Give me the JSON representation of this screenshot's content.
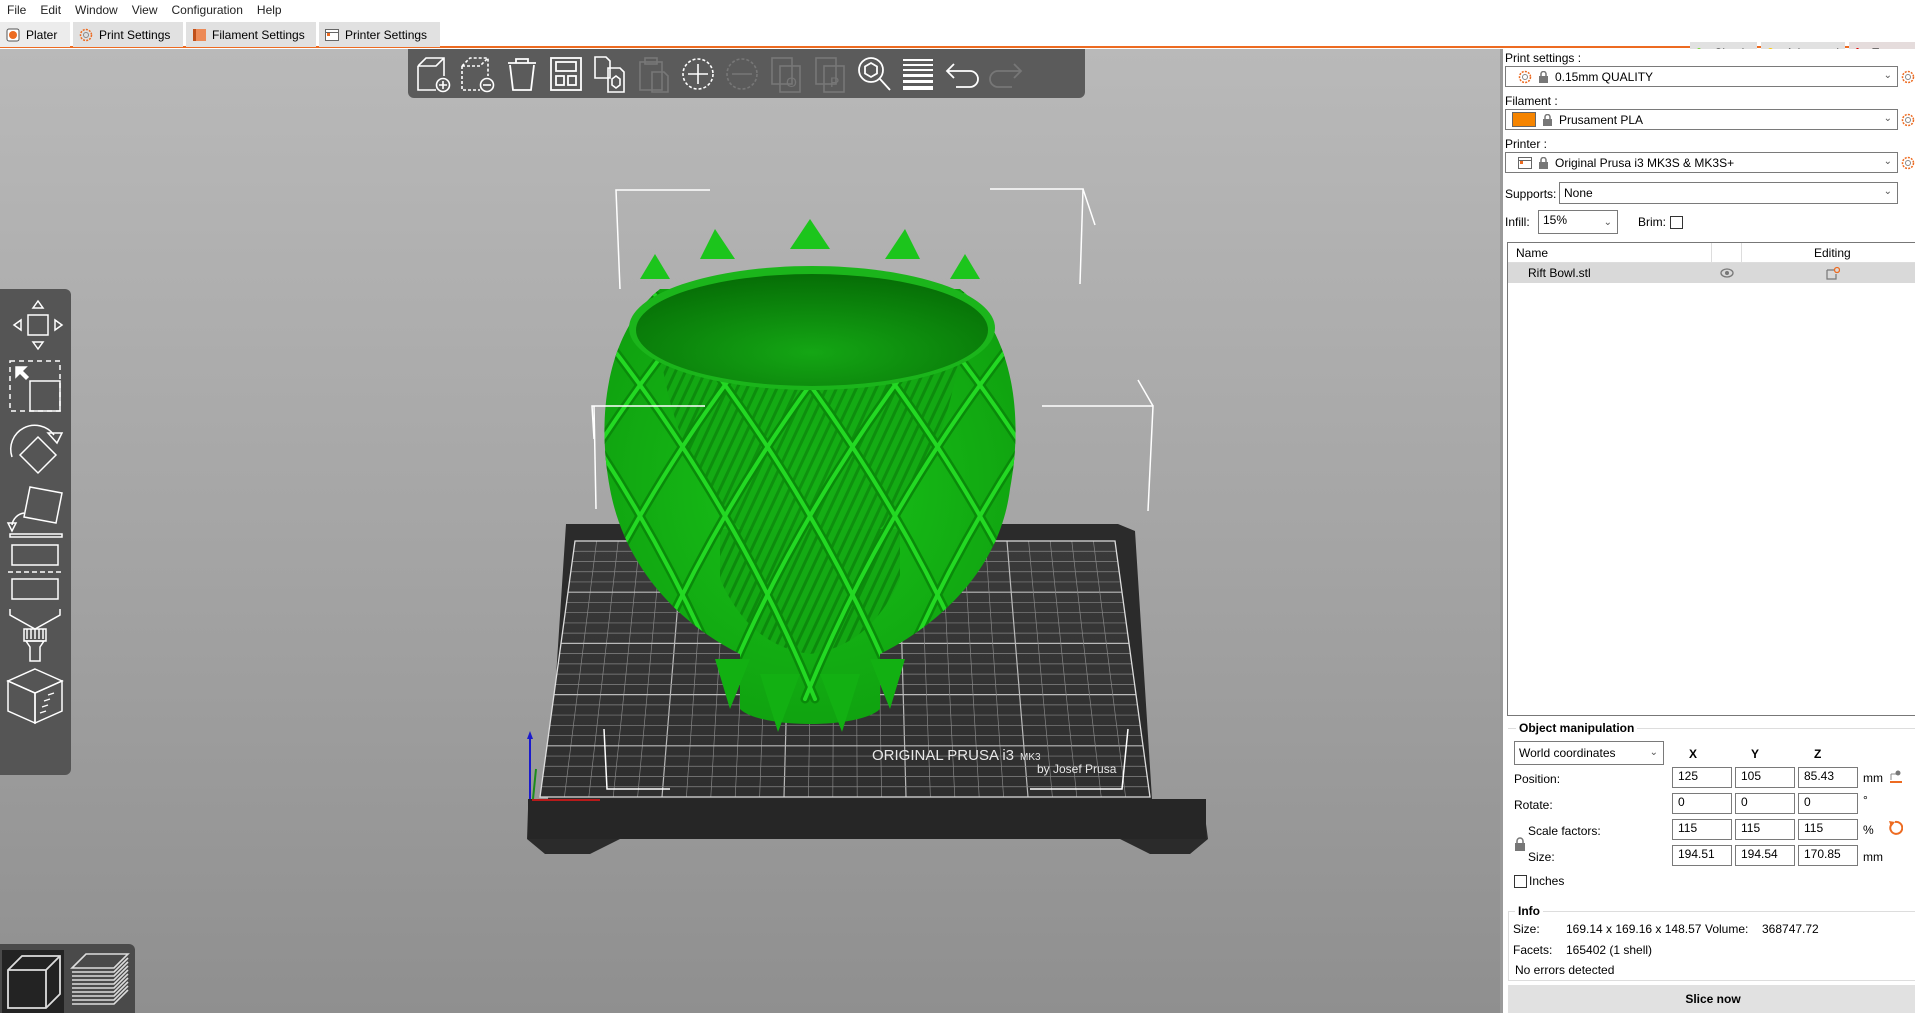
{
  "menu": [
    "File",
    "Edit",
    "Window",
    "View",
    "Configuration",
    "Help"
  ],
  "tabs": [
    {
      "label": "Plater",
      "icon": "plater-icon",
      "active": true
    },
    {
      "label": "Print Settings",
      "icon": "print-settings-icon"
    },
    {
      "label": "Filament Settings",
      "icon": "filament-icon"
    },
    {
      "label": "Printer Settings",
      "icon": "printer-icon"
    }
  ],
  "modes": [
    {
      "label": "Simple",
      "color": "#6dd42a"
    },
    {
      "label": "Advanced",
      "color": "#ffcc00"
    },
    {
      "label": "Expert",
      "color": "#e20000",
      "active": true
    }
  ],
  "toolbar": [
    "add",
    "delete",
    "delete-all",
    "arrange",
    "copy",
    "paste",
    "add-instance",
    "remove-instance",
    "split-objects",
    "split-parts",
    "search",
    "layers-editing",
    "undo",
    "redo"
  ],
  "left_tools": [
    "move",
    "scale",
    "rotate",
    "place-on-face",
    "cut",
    "paint-supports",
    "seam"
  ],
  "bed": {
    "label_line1": "ORIGINAL PRUSA i3",
    "label_small": "MK3",
    "label_line2": "by Josef Prusa"
  },
  "sidebar": {
    "print_settings_label": "Print settings :",
    "print_settings_value": "0.15mm QUALITY",
    "filament_label": "Filament :",
    "filament_value": "Prusament PLA",
    "filament_color": "#f58400",
    "printer_label": "Printer :",
    "printer_value": "Original Prusa i3 MK3S & MK3S+",
    "supports_label": "Supports:",
    "supports_value": "None",
    "infill_label": "Infill:",
    "infill_value": "15%",
    "brim_label": "Brim:",
    "brim_checked": false
  },
  "object_list": {
    "col_name": "Name",
    "col_editing": "Editing",
    "rows": [
      {
        "name": "Rift Bowl.stl"
      }
    ]
  },
  "manipulation": {
    "title": "Object manipulation",
    "coord_system": "World coordinates",
    "axes": [
      "X",
      "Y",
      "Z"
    ],
    "position_label": "Position:",
    "position": [
      "125",
      "105",
      "85.43"
    ],
    "position_unit": "mm",
    "rotate_label": "Rotate:",
    "rotate": [
      "0",
      "0",
      "0"
    ],
    "rotate_unit": "°",
    "scale_label": "Scale factors:",
    "scale": [
      "115",
      "115",
      "115"
    ],
    "scale_unit": "%",
    "size_label": "Size:",
    "size": [
      "194.51",
      "194.54",
      "170.85"
    ],
    "size_unit": "mm",
    "inches_label": "Inches"
  },
  "info": {
    "title": "Info",
    "size_label": "Size:",
    "size_value": "169.14 x 169.16 x 148.57",
    "volume_label": "Volume:",
    "volume_value": "368747.72",
    "facets_label": "Facets:",
    "facets_value": "165402 (1 shell)",
    "errors": "No errors detected"
  },
  "slice_button": "Slice now"
}
